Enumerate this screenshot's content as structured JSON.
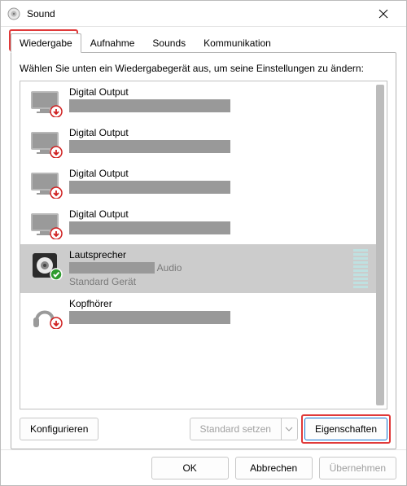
{
  "titlebar": {
    "title": "Sound"
  },
  "tabs": {
    "items": [
      {
        "label": "Wiedergabe"
      },
      {
        "label": "Aufnahme"
      },
      {
        "label": "Sounds"
      },
      {
        "label": "Kommunikation"
      }
    ],
    "active_index": 0
  },
  "instruction": "Wählen Sie unten ein Wiedergabegerät aus, um seine Einstellungen zu ändern:",
  "devices": [
    {
      "type": "monitor",
      "name": "Digital Output",
      "status": "down",
      "detail_redacted_width": 198
    },
    {
      "type": "monitor",
      "name": "Digital Output",
      "status": "down",
      "detail_redacted_width": 198
    },
    {
      "type": "monitor",
      "name": "Digital Output",
      "status": "down",
      "detail_redacted_width": 198
    },
    {
      "type": "monitor",
      "name": "Digital Output",
      "status": "down",
      "detail_redacted_width": 198
    },
    {
      "type": "speaker",
      "name": "Lautsprecher",
      "status": "default",
      "detail_after": "Audio",
      "subtext": "Standard Gerät",
      "selected": true,
      "vu": true
    },
    {
      "type": "headphones",
      "name": "Kopfhörer",
      "status": "down",
      "detail_redacted_width": 198
    }
  ],
  "panel_buttons": {
    "configure": "Konfigurieren",
    "set_default": "Standard setzen",
    "properties": "Eigenschaften"
  },
  "footer": {
    "ok": "OK",
    "cancel": "Abbrechen",
    "apply": "Übernehmen"
  }
}
